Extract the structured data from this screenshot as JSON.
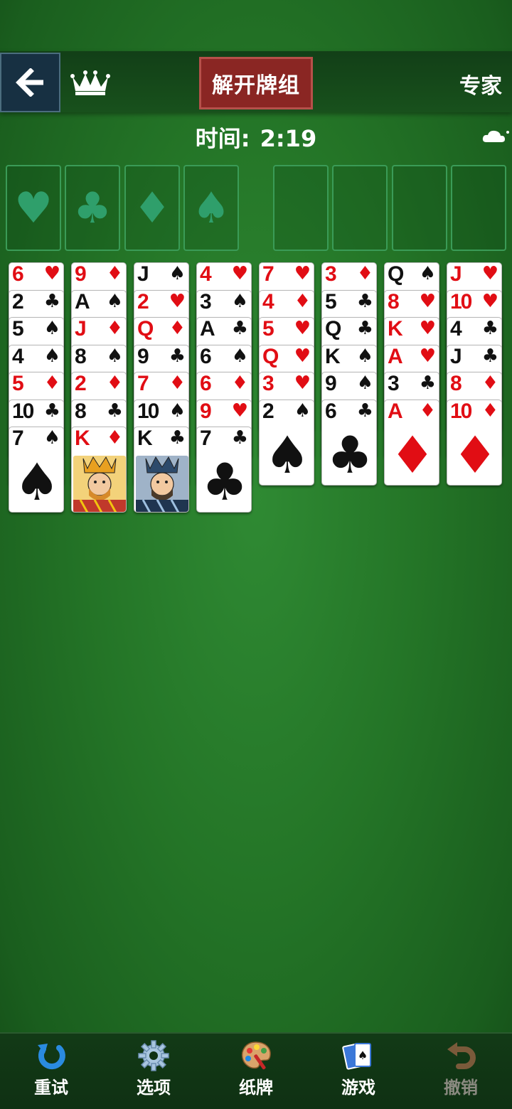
{
  "header": {
    "deal_button": "解开牌组",
    "difficulty": "专家"
  },
  "timer": {
    "label": "时间:",
    "value": "2:19"
  },
  "foundations": [
    {
      "suit": "♥"
    },
    {
      "suit": "♣"
    },
    {
      "suit": "♦"
    },
    {
      "suit": "♠"
    }
  ],
  "columns": [
    {
      "cards": [
        {
          "rank": "6",
          "suit": "♥",
          "color": "red"
        },
        {
          "rank": "2",
          "suit": "♣",
          "color": "black"
        },
        {
          "rank": "5",
          "suit": "♠",
          "color": "black"
        },
        {
          "rank": "4",
          "suit": "♠",
          "color": "black"
        },
        {
          "rank": "5",
          "suit": "♦",
          "color": "red"
        },
        {
          "rank": "10",
          "suit": "♣",
          "color": "black"
        },
        {
          "rank": "7",
          "suit": "♠",
          "color": "black"
        }
      ]
    },
    {
      "cards": [
        {
          "rank": "9",
          "suit": "♦",
          "color": "red"
        },
        {
          "rank": "A",
          "suit": "♠",
          "color": "black"
        },
        {
          "rank": "J",
          "suit": "♦",
          "color": "red"
        },
        {
          "rank": "8",
          "suit": "♠",
          "color": "black"
        },
        {
          "rank": "2",
          "suit": "♦",
          "color": "red"
        },
        {
          "rank": "8",
          "suit": "♣",
          "color": "black"
        },
        {
          "rank": "K",
          "suit": "♦",
          "color": "red",
          "face": true
        }
      ]
    },
    {
      "cards": [
        {
          "rank": "J",
          "suit": "♠",
          "color": "black"
        },
        {
          "rank": "2",
          "suit": "♥",
          "color": "red"
        },
        {
          "rank": "Q",
          "suit": "♦",
          "color": "red"
        },
        {
          "rank": "9",
          "suit": "♣",
          "color": "black"
        },
        {
          "rank": "7",
          "suit": "♦",
          "color": "red"
        },
        {
          "rank": "10",
          "suit": "♠",
          "color": "black"
        },
        {
          "rank": "K",
          "suit": "♣",
          "color": "black",
          "face": true
        }
      ]
    },
    {
      "cards": [
        {
          "rank": "4",
          "suit": "♥",
          "color": "red"
        },
        {
          "rank": "3",
          "suit": "♠",
          "color": "black"
        },
        {
          "rank": "A",
          "suit": "♣",
          "color": "black"
        },
        {
          "rank": "6",
          "suit": "♠",
          "color": "black"
        },
        {
          "rank": "6",
          "suit": "♦",
          "color": "red"
        },
        {
          "rank": "9",
          "suit": "♥",
          "color": "red"
        },
        {
          "rank": "7",
          "suit": "♣",
          "color": "black"
        }
      ]
    },
    {
      "cards": [
        {
          "rank": "7",
          "suit": "♥",
          "color": "red"
        },
        {
          "rank": "4",
          "suit": "♦",
          "color": "red"
        },
        {
          "rank": "5",
          "suit": "♥",
          "color": "red"
        },
        {
          "rank": "Q",
          "suit": "♥",
          "color": "red"
        },
        {
          "rank": "3",
          "suit": "♥",
          "color": "red"
        },
        {
          "rank": "2",
          "suit": "♠",
          "color": "black"
        }
      ]
    },
    {
      "cards": [
        {
          "rank": "3",
          "suit": "♦",
          "color": "red"
        },
        {
          "rank": "5",
          "suit": "♣",
          "color": "black"
        },
        {
          "rank": "Q",
          "suit": "♣",
          "color": "black"
        },
        {
          "rank": "K",
          "suit": "♠",
          "color": "black"
        },
        {
          "rank": "9",
          "suit": "♠",
          "color": "black"
        },
        {
          "rank": "6",
          "suit": "♣",
          "color": "black"
        }
      ]
    },
    {
      "cards": [
        {
          "rank": "Q",
          "suit": "♠",
          "color": "black"
        },
        {
          "rank": "8",
          "suit": "♥",
          "color": "red"
        },
        {
          "rank": "K",
          "suit": "♥",
          "color": "red"
        },
        {
          "rank": "A",
          "suit": "♥",
          "color": "red"
        },
        {
          "rank": "3",
          "suit": "♣",
          "color": "black"
        },
        {
          "rank": "A",
          "suit": "♦",
          "color": "red"
        }
      ]
    },
    {
      "cards": [
        {
          "rank": "J",
          "suit": "♥",
          "color": "red"
        },
        {
          "rank": "10",
          "suit": "♥",
          "color": "red"
        },
        {
          "rank": "4",
          "suit": "♣",
          "color": "black"
        },
        {
          "rank": "J",
          "suit": "♣",
          "color": "black"
        },
        {
          "rank": "8",
          "suit": "♦",
          "color": "red"
        },
        {
          "rank": "10",
          "suit": "♦",
          "color": "red"
        }
      ]
    }
  ],
  "bottom_nav": [
    {
      "label": "重试",
      "icon": "retry-icon",
      "enabled": true
    },
    {
      "label": "选项",
      "icon": "gear-icon",
      "enabled": true
    },
    {
      "label": "纸牌",
      "icon": "palette-icon",
      "enabled": true
    },
    {
      "label": "游戏",
      "icon": "cards-icon",
      "enabled": true
    },
    {
      "label": "撤销",
      "icon": "undo-icon",
      "enabled": false
    }
  ],
  "colors": {
    "felt": "#247527",
    "deal_button": "#8a2623",
    "red_suit": "#e10d14",
    "slot_border": "#3a9b57"
  }
}
